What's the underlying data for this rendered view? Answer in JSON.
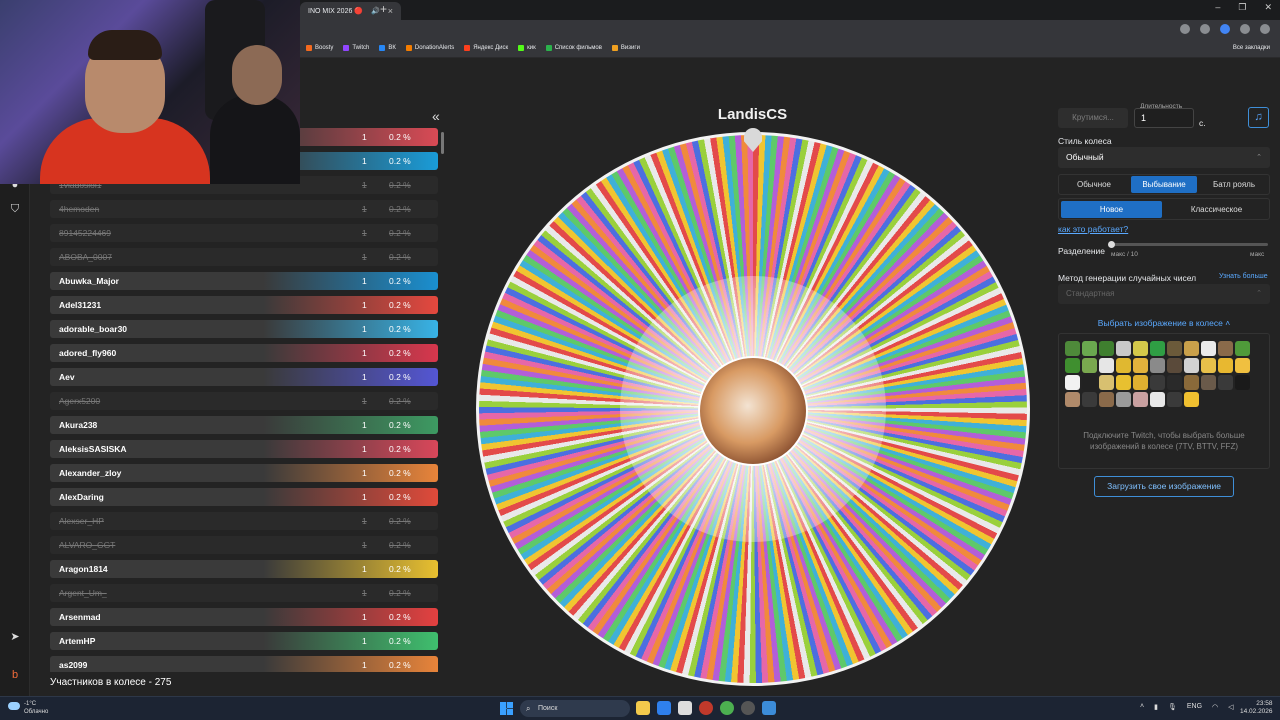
{
  "browser": {
    "tab_title": "INO MIX 2026 🔴",
    "bookmarks": [
      "Boosty",
      "Twitch",
      "ВК",
      "DonationAlerts",
      "Яндекс Диск",
      "кик",
      "Список фильмов",
      "Визиги"
    ],
    "bookmark_colors": [
      "#f46a1e",
      "#9146ff",
      "#2787f5",
      "#f57d00",
      "#fc3f1d",
      "#53fc18",
      "#2bb24c",
      "#f0a020"
    ],
    "bookmarks_right": "Все закладки"
  },
  "participants": {
    "rows": [
      {
        "name": "",
        "count": "1",
        "pct": "0.2 %",
        "color": "#d94a55",
        "out": false
      },
      {
        "name": "",
        "count": "1",
        "pct": "0.2 %",
        "color": "#1a9cd8",
        "out": false
      },
      {
        "name": "1vladoslol1",
        "count": "1",
        "pct": "0.2 %",
        "color": "#555",
        "out": true
      },
      {
        "name": "4hemoden",
        "count": "1",
        "pct": "0.2 %",
        "color": "#555",
        "out": true
      },
      {
        "name": "89145224469",
        "count": "1",
        "pct": "0.2 %",
        "color": "#555",
        "out": true
      },
      {
        "name": "ABOBA_0007",
        "count": "1",
        "pct": "0.2 %",
        "color": "#555",
        "out": true
      },
      {
        "name": "Abuwka_Major",
        "count": "1",
        "pct": "0.2 %",
        "color": "#1a8fd0",
        "out": false
      },
      {
        "name": "Adel31231",
        "count": "1",
        "pct": "0.2 %",
        "color": "#e5483e",
        "out": false
      },
      {
        "name": "adorable_boar30",
        "count": "1",
        "pct": "0.2 %",
        "color": "#38b3e6",
        "out": false
      },
      {
        "name": "adored_fly960",
        "count": "1",
        "pct": "0.2 %",
        "color": "#d8374d",
        "out": false
      },
      {
        "name": "Aev",
        "count": "1",
        "pct": "0.2 %",
        "color": "#5456d4",
        "out": false
      },
      {
        "name": "Agerx5200",
        "count": "1",
        "pct": "0.2 %",
        "color": "#555",
        "out": true
      },
      {
        "name": "Akura238",
        "count": "1",
        "pct": "0.2 %",
        "color": "#3d9a62",
        "out": false
      },
      {
        "name": "AleksisSASISKA",
        "count": "1",
        "pct": "0.2 %",
        "color": "#d9475a",
        "out": false
      },
      {
        "name": "Alexander_zloy",
        "count": "1",
        "pct": "0.2 %",
        "color": "#e8843a",
        "out": false
      },
      {
        "name": "AlexDaring",
        "count": "1",
        "pct": "0.2 %",
        "color": "#e04a3a",
        "out": false
      },
      {
        "name": "Alexser_HP",
        "count": "1",
        "pct": "0.2 %",
        "color": "#555",
        "out": true
      },
      {
        "name": "ALVARO_GGT",
        "count": "1",
        "pct": "0.2 %",
        "color": "#555",
        "out": true
      },
      {
        "name": "Aragon1814",
        "count": "1",
        "pct": "0.2 %",
        "color": "#e8c030",
        "out": false
      },
      {
        "name": "Argent_Um_",
        "count": "1",
        "pct": "0.2 %",
        "color": "#555",
        "out": true
      },
      {
        "name": "Arsenmad",
        "count": "1",
        "pct": "0.2 %",
        "color": "#e44040",
        "out": false
      },
      {
        "name": "ArtemHP",
        "count": "1",
        "pct": "0.2 %",
        "color": "#3fbf6e",
        "out": false
      },
      {
        "name": "as2099",
        "count": "1",
        "pct": "0.2 %",
        "color": "#e8843a",
        "out": false
      }
    ],
    "count_label": "Участников в колесе - 275"
  },
  "wheel": {
    "winner_label": "LandisCS"
  },
  "settings": {
    "spin_button": "Крутимся...",
    "duration_label": "Длительность",
    "duration_value": "1",
    "duration_unit": "с.",
    "wheel_style_label": "Стиль колеса",
    "wheel_style_value": "Обычный",
    "modes": [
      "Обычное",
      "Выбывание",
      "Батл рояль"
    ],
    "active_mode": "Выбывание",
    "submodes": [
      "Новое",
      "Классическое"
    ],
    "active_submode": "Новое",
    "how_link": "как это работает?",
    "split_label": "Разделение",
    "split_min": "макс / 10",
    "split_max": "макс",
    "split_value": 0,
    "rng_label": "Метод генерации случайных чисел",
    "rng_link": "Узнать больше",
    "rng_value": "Стандартная",
    "image_toggle": "Выбрать изображение в колесе",
    "image_note": "Подключите Twitch, чтобы выбрать больше изображений в колесе (7TV, BTTV, FFZ)",
    "upload_button": "Загрузить свое изображение",
    "emote_colors": [
      "#4e8a3a",
      "#6aa84f",
      "#3f7f2f",
      "#c9c9c9",
      "#d4c84a",
      "#2f9e44",
      "#6b5a3a",
      "#c9a04a",
      "#eaeaea",
      "#8a6a4a",
      "#4f9a3a",
      "#3f8f2f",
      "#7aa84f",
      "#e6e6e6",
      "#e0b830",
      "#e3b23c",
      "#8a8a8a",
      "#5a4a3a",
      "#d2d2d2",
      "#e8c04a",
      "#e8b830",
      "#f0c040",
      "#f2f2f2",
      "#222",
      "#d8c070",
      "#e8c030",
      "#e0b030",
      "#3a3a3a",
      "#2a2a2a",
      "#8a6a3a",
      "#6a5a4a",
      "#3a3a3a",
      "#1a1a1a",
      "#b08a6a",
      "#3a3a3a",
      "#8a6a4a",
      "#9a9a9a",
      "#c9a0a0",
      "#e8e8e8",
      "#3a3a3a",
      "#f0c030"
    ]
  },
  "taskbar": {
    "weather_temp": "-1°C",
    "weather_desc": "Облачно",
    "search_placeholder": "Поиск",
    "language": "ENG",
    "time": "23:58",
    "date": "14.02.2026"
  }
}
